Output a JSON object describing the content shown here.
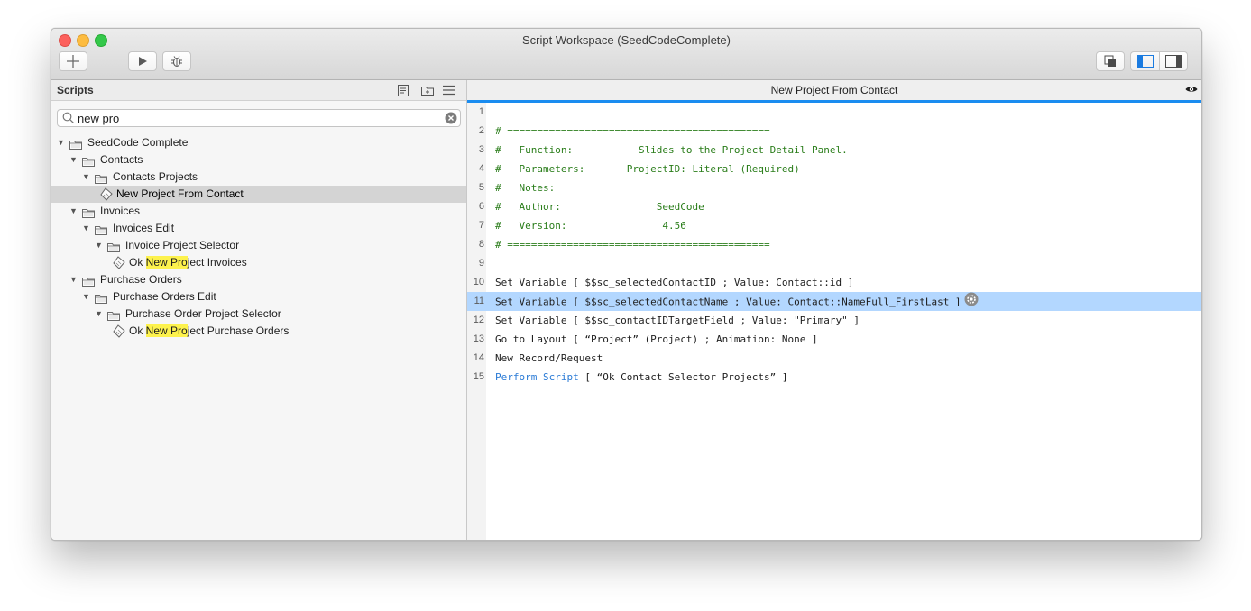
{
  "window": {
    "title": "Script Workspace (SeedCodeComplete)"
  },
  "sidebar": {
    "title": "Scripts",
    "search": {
      "value": "new pro",
      "placeholder": ""
    }
  },
  "tree": [
    {
      "label": "SeedCode Complete",
      "type": "folder",
      "level": 0
    },
    {
      "label": "Contacts",
      "type": "folder",
      "level": 1
    },
    {
      "label": "Contacts Projects",
      "type": "folder",
      "level": 2
    },
    {
      "label": "New Project From Contact",
      "type": "script",
      "level": 3,
      "selected": true
    },
    {
      "label": "Invoices",
      "type": "folder",
      "level": 1
    },
    {
      "label": "Invoices Edit",
      "type": "folder",
      "level": 2
    },
    {
      "label": "Invoice Project Selector",
      "type": "folder",
      "level": 3
    },
    {
      "label": "Ok New Project Invoices",
      "type": "script",
      "level": 4,
      "highlight": "New Pro"
    },
    {
      "label": "Purchase Orders",
      "type": "folder",
      "level": 1
    },
    {
      "label": "Purchase Orders Edit",
      "type": "folder",
      "level": 2
    },
    {
      "label": "Purchase Order Project Selector",
      "type": "folder",
      "level": 3
    },
    {
      "label": "Ok New Project Purchase Orders",
      "type": "script",
      "level": 4,
      "highlight": "New Pro"
    }
  ],
  "editor": {
    "title": "New Project From Contact",
    "lines": [
      {
        "n": "1",
        "segments": []
      },
      {
        "n": "2",
        "segments": [
          {
            "text": "# ============================================",
            "kind": "comment"
          }
        ]
      },
      {
        "n": "3",
        "segments": [
          {
            "text": "#   Function:           Slides to the Project Detail Panel.",
            "kind": "comment"
          }
        ]
      },
      {
        "n": "4",
        "segments": [
          {
            "text": "#   Parameters:       ProjectID: Literal (Required)",
            "kind": "comment"
          }
        ]
      },
      {
        "n": "5",
        "segments": [
          {
            "text": "#   Notes:",
            "kind": "comment"
          }
        ]
      },
      {
        "n": "6",
        "segments": [
          {
            "text": "#   Author:                SeedCode",
            "kind": "comment"
          }
        ]
      },
      {
        "n": "7",
        "segments": [
          {
            "text": "#   Version:                4.56",
            "kind": "comment"
          }
        ]
      },
      {
        "n": "8",
        "segments": [
          {
            "text": "# ============================================",
            "kind": "comment"
          }
        ]
      },
      {
        "n": "9",
        "segments": []
      },
      {
        "n": "10",
        "segments": [
          {
            "text": "Set Variable [ $$sc_selectedContactID ; Value: Contact::id ]",
            "kind": "plain"
          }
        ]
      },
      {
        "n": "11",
        "segments": [
          {
            "text": "Set Variable [ $$sc_selectedContactName ; Value: Contact::NameFull_FirstLast ]",
            "kind": "plain"
          }
        ],
        "selected": true
      },
      {
        "n": "12",
        "segments": [
          {
            "text": "Set Variable [ $$sc_contactIDTargetField ; Value: \"Primary\" ]",
            "kind": "plain"
          }
        ]
      },
      {
        "n": "13",
        "segments": [
          {
            "text": "Go to Layout [ “Project” (Project) ; Animation: None ]",
            "kind": "plain"
          }
        ]
      },
      {
        "n": "14",
        "segments": [
          {
            "text": "New Record/Request",
            "kind": "plain"
          }
        ]
      },
      {
        "n": "15",
        "segments": [
          {
            "text": "Perform Script",
            "kind": "keyword"
          },
          {
            "text": " [ “Ok Contact Selector Projects” ]",
            "kind": "plain"
          }
        ]
      }
    ]
  },
  "colors": {
    "accent": "#1a8cf0",
    "comment": "#2a7d1a",
    "keyword": "#2b7bd6",
    "selection": "#b3d7ff",
    "search_highlight": "#fdf24d"
  },
  "icons": [
    "add-icon",
    "play-icon",
    "debug-bug-icon",
    "copy-icon",
    "left-panel-icon",
    "right-panel-icon",
    "new-script-icon",
    "new-folder-icon",
    "list-icon",
    "search-icon",
    "clear-icon",
    "folder-icon",
    "script-icon",
    "eye-icon",
    "gear-icon"
  ]
}
